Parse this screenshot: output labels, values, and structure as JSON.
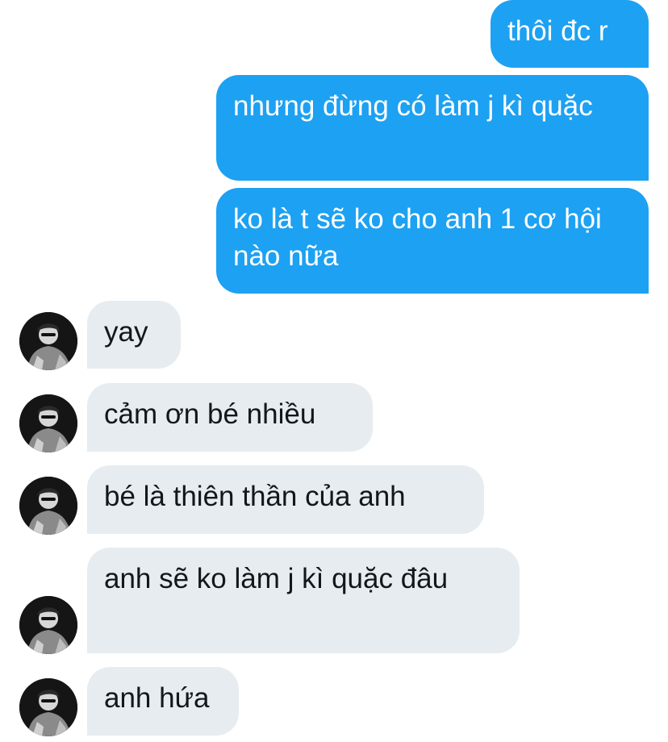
{
  "conversation": {
    "outgoing": [
      {
        "text": "thôi đc r"
      },
      {
        "text": "nhưng đừng có làm j kì quặc"
      },
      {
        "text": "ko là t sẽ ko cho anh 1 cơ hội nào nữa"
      }
    ],
    "incoming": [
      {
        "text": "yay"
      },
      {
        "text": "cảm ơn bé nhiều"
      },
      {
        "text": "bé là thiên thần của anh"
      },
      {
        "text": "anh sẽ ko làm j kì quặc đâu"
      },
      {
        "text": "anh hứa"
      }
    ]
  },
  "colors": {
    "outgoing_bubble": "#1da1f2",
    "outgoing_text": "#ffffff",
    "incoming_bubble": "#e6ecf0",
    "incoming_text": "#14171a"
  }
}
